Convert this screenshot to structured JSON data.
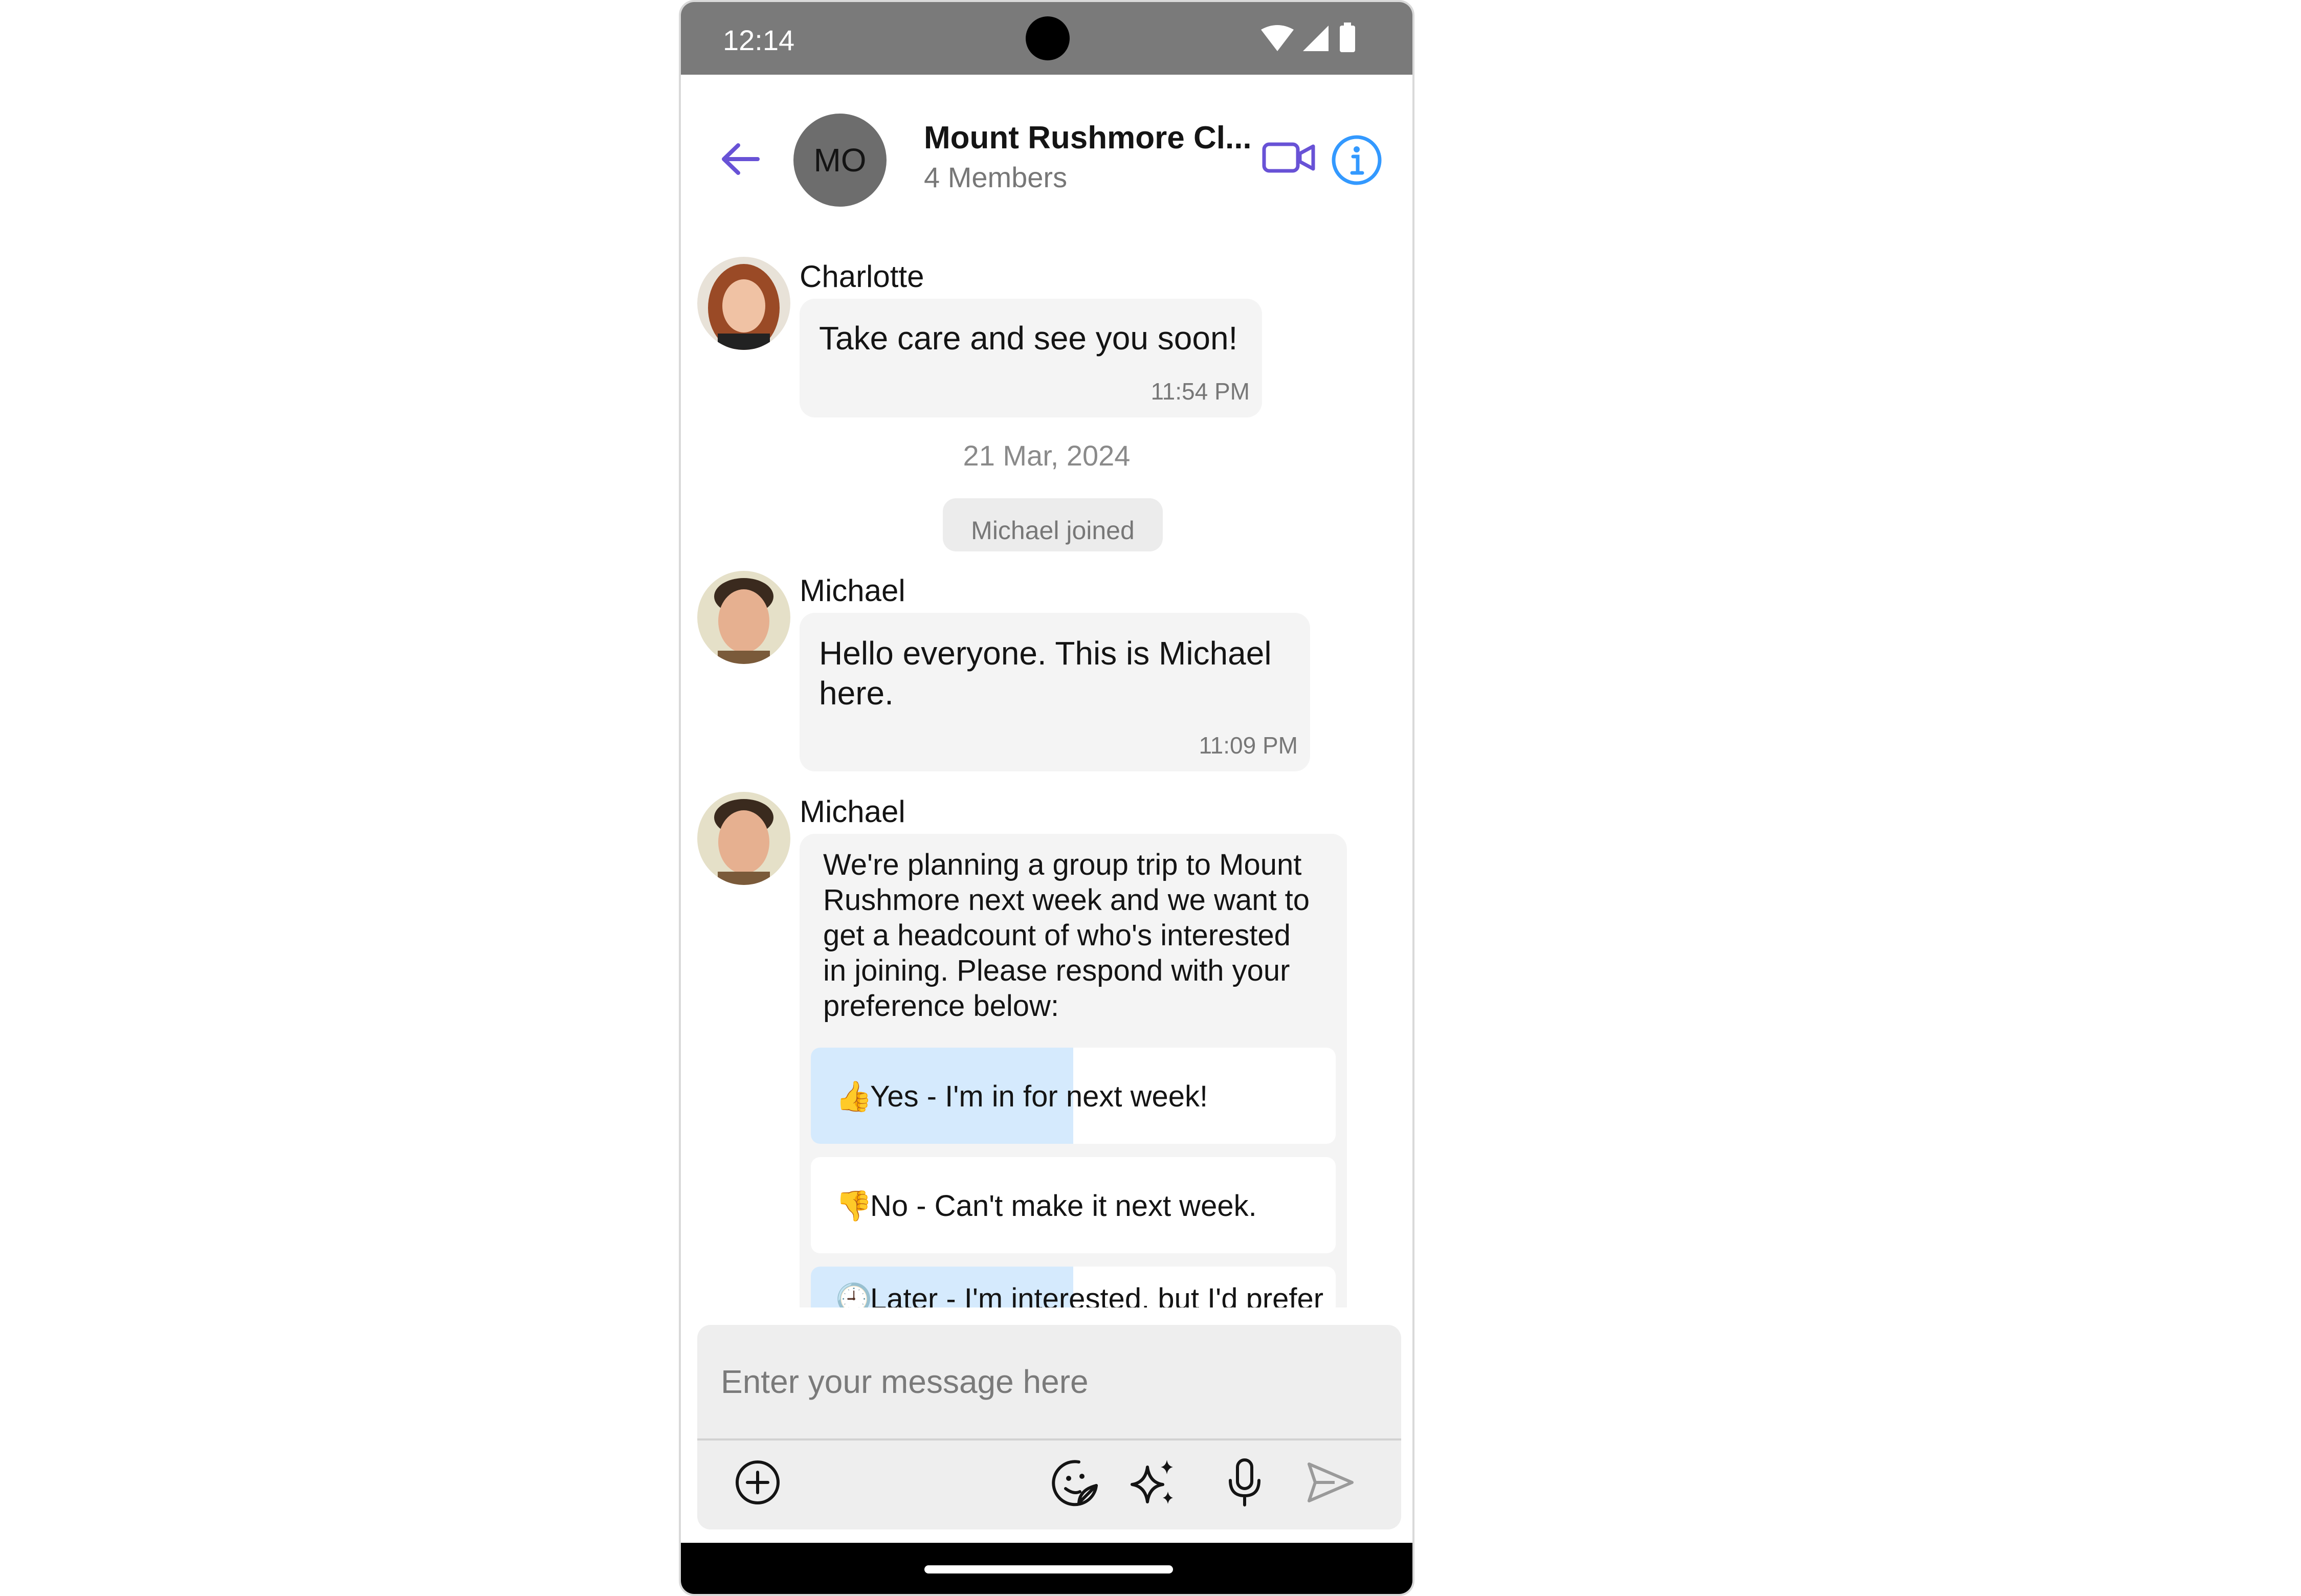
{
  "status_bar": {
    "time": "12:14"
  },
  "header": {
    "avatar_initials": "MO",
    "group_name": "Mount Rushmore Cl...",
    "members": "4 Members"
  },
  "messages": [
    {
      "sender": "Charlotte",
      "text": "Take care and see you soon!",
      "time": "11:54 PM"
    },
    {
      "sender": "Michael",
      "text_line1": "Hello everyone. This is Michael",
      "text_line2": "here.",
      "time": "11:09 PM"
    },
    {
      "sender": "Michael",
      "poll_question": [
        "We're planning a group trip to Mount",
        "Rushmore next week and we want to",
        "get a headcount of who's interested",
        "in joining. Please respond with your",
        "preference below:"
      ],
      "poll_options": [
        {
          "emoji": "👍",
          "label": "Yes - I'm in for next week!",
          "vote_fraction": 0.5
        },
        {
          "emoji": "👎",
          "label": "No - Can't make it next week.",
          "vote_fraction": 0
        },
        {
          "emoji": "🕘",
          "label": "Later - I'm interested, but I'd prefer",
          "vote_fraction": 0.5
        }
      ]
    }
  ],
  "date_separator": "21 Mar, 2024",
  "action_message": "Michael joined",
  "composer": {
    "placeholder": "Enter your message here"
  },
  "colors": {
    "accent": "#6852d6",
    "info": "#3399ff",
    "poll_fill": "#d5eafd",
    "bubble": "#f4f4f4"
  }
}
